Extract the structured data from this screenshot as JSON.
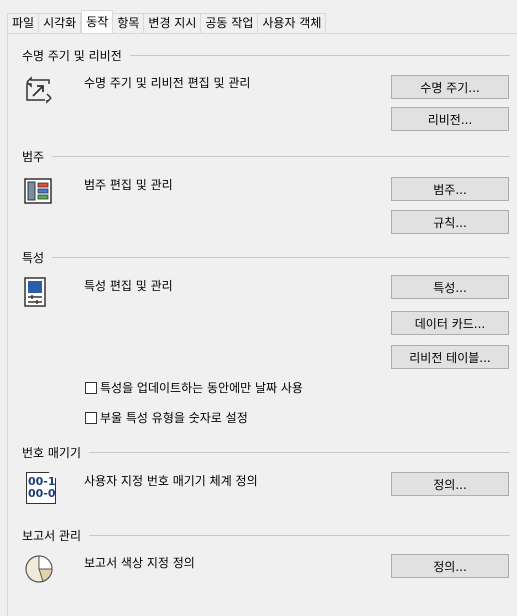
{
  "tabs": [
    {
      "label": "파일"
    },
    {
      "label": "시각화"
    },
    {
      "label": "동작",
      "active": true
    },
    {
      "label": "항목"
    },
    {
      "label": "변경 지시"
    },
    {
      "label": "공동 작업"
    },
    {
      "label": "사용자 객체"
    }
  ],
  "lifecycle": {
    "header": "수명 주기 및 리비전",
    "desc": "수명 주기 및 리비전 편집 및 관리",
    "btn_lifecycle": "수명 주기...",
    "btn_revision": "리비전...",
    "icon": "lifecycle-arrows-icon"
  },
  "category": {
    "header": "범주",
    "desc": "범주 편집 및 관리",
    "btn_category": "범주...",
    "btn_rules": "규칙...",
    "icon": "category-panel-icon"
  },
  "properties": {
    "header": "특성",
    "desc": "특성 편집 및 관리",
    "btn_properties": "특성...",
    "btn_data_cards": "데이터 카드...",
    "btn_revision_table": "리비전 테이블...",
    "check_update_date": "특성을 업데이트하는 동안에만 날짜 사용",
    "check_boolean_numeric": "부울 특성 유형을 숫자로 설정",
    "icon": "properties-sheet-icon"
  },
  "numbering": {
    "header": "번호 매기기",
    "desc": "사용자 지정 번호 매기기 체계 정의",
    "btn_define": "정의...",
    "icon_line1": "00-1",
    "icon_line2": "00-0"
  },
  "report": {
    "header": "보고서 관리",
    "desc": "보고서 색상 지정 정의",
    "btn_define": "정의...",
    "icon": "pie-chart-icon"
  }
}
